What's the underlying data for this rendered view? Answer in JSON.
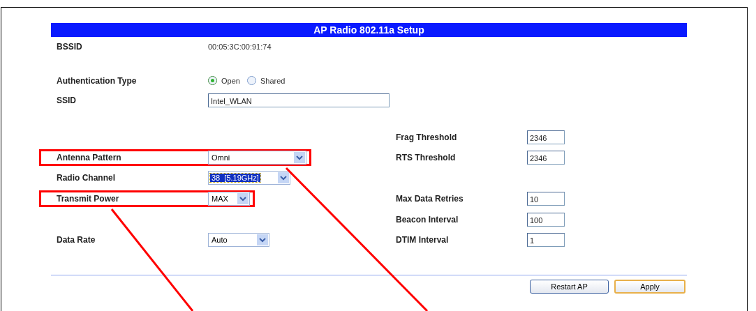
{
  "title": "AP Radio 802.11a Setup",
  "left_fields": [
    {
      "kind": "text",
      "label": "BSSID",
      "value": "00:05:3C:00:91:74",
      "highlighted": false
    },
    {
      "kind": "radio",
      "label": "Authentication Type",
      "options": [
        {
          "label": "Open",
          "selected": true
        },
        {
          "label": "Shared",
          "selected": false
        }
      ],
      "highlighted": false
    },
    {
      "kind": "input",
      "label": "SSID",
      "value": "Intel_WLAN",
      "highlighted": false
    },
    {
      "kind": "select",
      "label": "Antenna Pattern",
      "value": "Omni",
      "focused": false,
      "highlighted": true
    },
    {
      "kind": "select",
      "label": "Radio Channel",
      "value": "38  [5.19GHz]",
      "focused": true,
      "highlighted": false
    },
    {
      "kind": "select",
      "label": "Transmit Power",
      "value": "MAX",
      "focused": false,
      "highlighted": true
    },
    {
      "kind": "select",
      "label": "Data Rate",
      "value": "Auto",
      "focused": false,
      "highlighted": false
    }
  ],
  "right_fields": [
    {
      "label": "Frag Threshold",
      "value": "2346"
    },
    {
      "label": "RTS Threshold",
      "value": "2346"
    },
    {
      "label": "Max Data Retries",
      "value": "10"
    },
    {
      "label": "Beacon Interval",
      "value": "100"
    },
    {
      "label": "DTIM Interval",
      "value": "1"
    }
  ],
  "buttons": [
    {
      "label": "Restart AP",
      "default": false
    },
    {
      "label": "Apply",
      "default": true
    }
  ]
}
